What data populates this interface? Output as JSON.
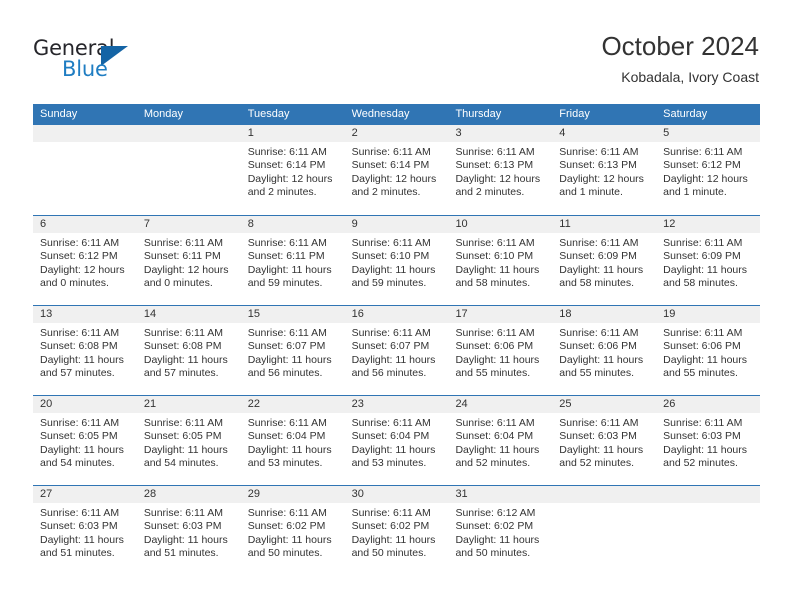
{
  "brand": {
    "name_top": "General",
    "name_bottom": "Blue",
    "triangle_icon": "blue-triangle-logo-mark",
    "accent_color": "#1f7dc2",
    "mark_color": "#1464a5"
  },
  "header": {
    "title": "October 2024",
    "subtitle": "Kobadala, Ivory Coast"
  },
  "calendar": {
    "header_background": "#3075b4",
    "header_text_color": "#ffffff",
    "day_band_color": "#f0f0f0",
    "weekdays": [
      "Sunday",
      "Monday",
      "Tuesday",
      "Wednesday",
      "Thursday",
      "Friday",
      "Saturday"
    ],
    "weeks": [
      [
        {
          "day": "",
          "lines": []
        },
        {
          "day": "",
          "lines": []
        },
        {
          "day": "1",
          "lines": [
            "Sunrise: 6:11 AM",
            "Sunset: 6:14 PM",
            "Daylight: 12 hours",
            "and 2 minutes."
          ]
        },
        {
          "day": "2",
          "lines": [
            "Sunrise: 6:11 AM",
            "Sunset: 6:14 PM",
            "Daylight: 12 hours",
            "and 2 minutes."
          ]
        },
        {
          "day": "3",
          "lines": [
            "Sunrise: 6:11 AM",
            "Sunset: 6:13 PM",
            "Daylight: 12 hours",
            "and 2 minutes."
          ]
        },
        {
          "day": "4",
          "lines": [
            "Sunrise: 6:11 AM",
            "Sunset: 6:13 PM",
            "Daylight: 12 hours",
            "and 1 minute."
          ]
        },
        {
          "day": "5",
          "lines": [
            "Sunrise: 6:11 AM",
            "Sunset: 6:12 PM",
            "Daylight: 12 hours",
            "and 1 minute."
          ]
        }
      ],
      [
        {
          "day": "6",
          "lines": [
            "Sunrise: 6:11 AM",
            "Sunset: 6:12 PM",
            "Daylight: 12 hours",
            "and 0 minutes."
          ]
        },
        {
          "day": "7",
          "lines": [
            "Sunrise: 6:11 AM",
            "Sunset: 6:11 PM",
            "Daylight: 12 hours",
            "and 0 minutes."
          ]
        },
        {
          "day": "8",
          "lines": [
            "Sunrise: 6:11 AM",
            "Sunset: 6:11 PM",
            "Daylight: 11 hours",
            "and 59 minutes."
          ]
        },
        {
          "day": "9",
          "lines": [
            "Sunrise: 6:11 AM",
            "Sunset: 6:10 PM",
            "Daylight: 11 hours",
            "and 59 minutes."
          ]
        },
        {
          "day": "10",
          "lines": [
            "Sunrise: 6:11 AM",
            "Sunset: 6:10 PM",
            "Daylight: 11 hours",
            "and 58 minutes."
          ]
        },
        {
          "day": "11",
          "lines": [
            "Sunrise: 6:11 AM",
            "Sunset: 6:09 PM",
            "Daylight: 11 hours",
            "and 58 minutes."
          ]
        },
        {
          "day": "12",
          "lines": [
            "Sunrise: 6:11 AM",
            "Sunset: 6:09 PM",
            "Daylight: 11 hours",
            "and 58 minutes."
          ]
        }
      ],
      [
        {
          "day": "13",
          "lines": [
            "Sunrise: 6:11 AM",
            "Sunset: 6:08 PM",
            "Daylight: 11 hours",
            "and 57 minutes."
          ]
        },
        {
          "day": "14",
          "lines": [
            "Sunrise: 6:11 AM",
            "Sunset: 6:08 PM",
            "Daylight: 11 hours",
            "and 57 minutes."
          ]
        },
        {
          "day": "15",
          "lines": [
            "Sunrise: 6:11 AM",
            "Sunset: 6:07 PM",
            "Daylight: 11 hours",
            "and 56 minutes."
          ]
        },
        {
          "day": "16",
          "lines": [
            "Sunrise: 6:11 AM",
            "Sunset: 6:07 PM",
            "Daylight: 11 hours",
            "and 56 minutes."
          ]
        },
        {
          "day": "17",
          "lines": [
            "Sunrise: 6:11 AM",
            "Sunset: 6:06 PM",
            "Daylight: 11 hours",
            "and 55 minutes."
          ]
        },
        {
          "day": "18",
          "lines": [
            "Sunrise: 6:11 AM",
            "Sunset: 6:06 PM",
            "Daylight: 11 hours",
            "and 55 minutes."
          ]
        },
        {
          "day": "19",
          "lines": [
            "Sunrise: 6:11 AM",
            "Sunset: 6:06 PM",
            "Daylight: 11 hours",
            "and 55 minutes."
          ]
        }
      ],
      [
        {
          "day": "20",
          "lines": [
            "Sunrise: 6:11 AM",
            "Sunset: 6:05 PM",
            "Daylight: 11 hours",
            "and 54 minutes."
          ]
        },
        {
          "day": "21",
          "lines": [
            "Sunrise: 6:11 AM",
            "Sunset: 6:05 PM",
            "Daylight: 11 hours",
            "and 54 minutes."
          ]
        },
        {
          "day": "22",
          "lines": [
            "Sunrise: 6:11 AM",
            "Sunset: 6:04 PM",
            "Daylight: 11 hours",
            "and 53 minutes."
          ]
        },
        {
          "day": "23",
          "lines": [
            "Sunrise: 6:11 AM",
            "Sunset: 6:04 PM",
            "Daylight: 11 hours",
            "and 53 minutes."
          ]
        },
        {
          "day": "24",
          "lines": [
            "Sunrise: 6:11 AM",
            "Sunset: 6:04 PM",
            "Daylight: 11 hours",
            "and 52 minutes."
          ]
        },
        {
          "day": "25",
          "lines": [
            "Sunrise: 6:11 AM",
            "Sunset: 6:03 PM",
            "Daylight: 11 hours",
            "and 52 minutes."
          ]
        },
        {
          "day": "26",
          "lines": [
            "Sunrise: 6:11 AM",
            "Sunset: 6:03 PM",
            "Daylight: 11 hours",
            "and 52 minutes."
          ]
        }
      ],
      [
        {
          "day": "27",
          "lines": [
            "Sunrise: 6:11 AM",
            "Sunset: 6:03 PM",
            "Daylight: 11 hours",
            "and 51 minutes."
          ]
        },
        {
          "day": "28",
          "lines": [
            "Sunrise: 6:11 AM",
            "Sunset: 6:03 PM",
            "Daylight: 11 hours",
            "and 51 minutes."
          ]
        },
        {
          "day": "29",
          "lines": [
            "Sunrise: 6:11 AM",
            "Sunset: 6:02 PM",
            "Daylight: 11 hours",
            "and 50 minutes."
          ]
        },
        {
          "day": "30",
          "lines": [
            "Sunrise: 6:11 AM",
            "Sunset: 6:02 PM",
            "Daylight: 11 hours",
            "and 50 minutes."
          ]
        },
        {
          "day": "31",
          "lines": [
            "Sunrise: 6:12 AM",
            "Sunset: 6:02 PM",
            "Daylight: 11 hours",
            "and 50 minutes."
          ]
        },
        {
          "day": "",
          "lines": []
        },
        {
          "day": "",
          "lines": []
        }
      ]
    ]
  }
}
